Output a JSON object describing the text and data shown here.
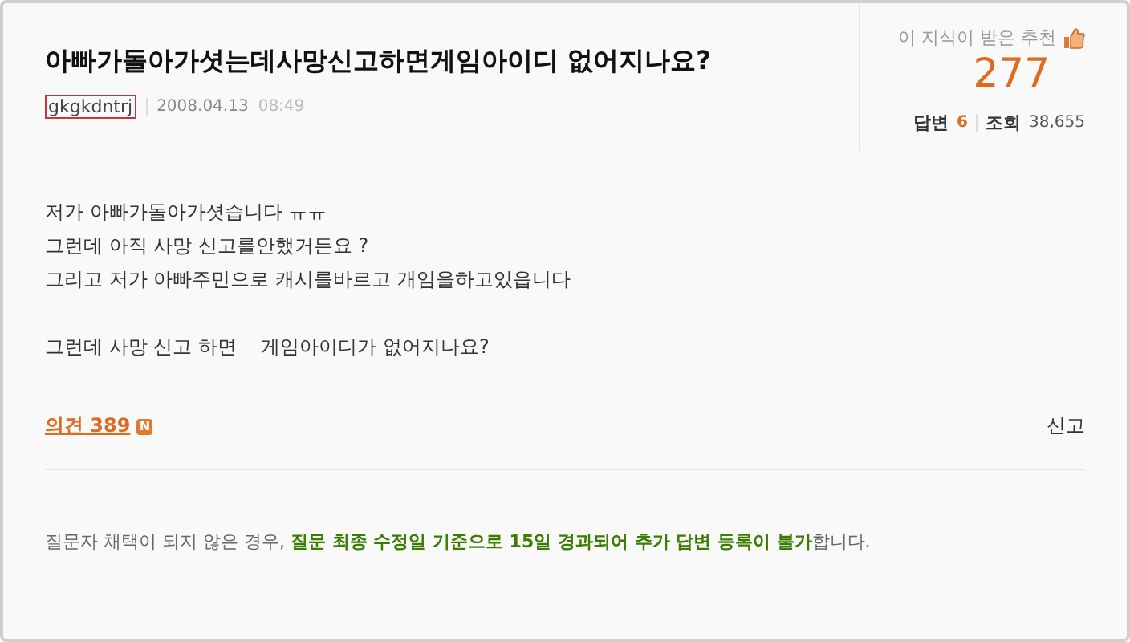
{
  "question": {
    "title": "아빠가돌아가셧는데사망신고하면게임아이디 없어지나요?",
    "author": "gkgkdntrj",
    "date": "2008.04.13",
    "time": "08:49"
  },
  "stats": {
    "recommend_label": "이 지식이 받은 추천",
    "recommend_count": "277",
    "answers_label": "답변",
    "answers_count": "6",
    "views_label": "조회",
    "views_count": "38,655"
  },
  "body": [
    [
      "저가 아빠가돌아가셧습니다 ㅠㅠ",
      "그런데 아직 사망 신고를안했거든요 ?",
      "그리고 저가 아빠주민으로 캐시를바르고 개임을하고있읍니다"
    ],
    [
      "그런데 사망 신고 하면    게임아이디가 없어지나요?"
    ]
  ],
  "opinions": {
    "label": "의견 389",
    "new_badge": "N"
  },
  "report": "신고",
  "notice": "질문자 채택이 되지 않은 경우, **질문 최종 수정일 기준으로 15일 경과되어 추가 답변 등록이 불가**합니다."
}
